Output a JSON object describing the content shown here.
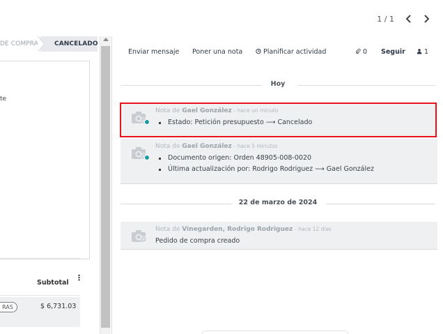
{
  "pager": {
    "value": "1 / 1",
    "prev_icon": "chevron-left-icon",
    "next_icon": "chevron-right-icon"
  },
  "statusbar": {
    "previous": "DE COMPRA",
    "current": "CANCELADO"
  },
  "form": {
    "fragment_text": "te",
    "lines": {
      "subtotal_header": "Subtotal",
      "options_icon": "⋮",
      "rows": [
        {
          "badge": "RAS",
          "subtotal": "$ 6,731.03"
        }
      ]
    }
  },
  "chatter": {
    "actions": {
      "send_message": "Enviar mensaje",
      "log_note": "Poner una nota",
      "schedule_activity": "Planificar actividad",
      "attachments_count": "0",
      "follow": "Seguir",
      "followers_count": "1"
    },
    "groups": [
      {
        "date": "Hoy",
        "messages": [
          {
            "prefix": "Nota de ",
            "author": "Gael González",
            "time": "- hace un minuto",
            "changes": [
              "Estado: Petición presupuesto ⟶ Cancelado"
            ]
          },
          {
            "prefix": "Nota de ",
            "author": "Gael González",
            "time": "- hace 5 minutos",
            "changes": [
              "Documento origen: Orden 48905-008-0020",
              "Última actualización por: Rodrigo Rodriguez ⟶ Gael González"
            ]
          }
        ]
      },
      {
        "date": "22 de marzo de 2024",
        "messages": [
          {
            "prefix": "Nota de ",
            "author": "Vinegarden, Rodrigo Rodriguez",
            "time": "- hace 12 días",
            "body": "Pedido de compra creado"
          }
        ]
      }
    ]
  },
  "colors": {
    "highlight": "#e8121a",
    "online_dot": "#1a9aa0",
    "message_bg": "#eef0f2"
  }
}
